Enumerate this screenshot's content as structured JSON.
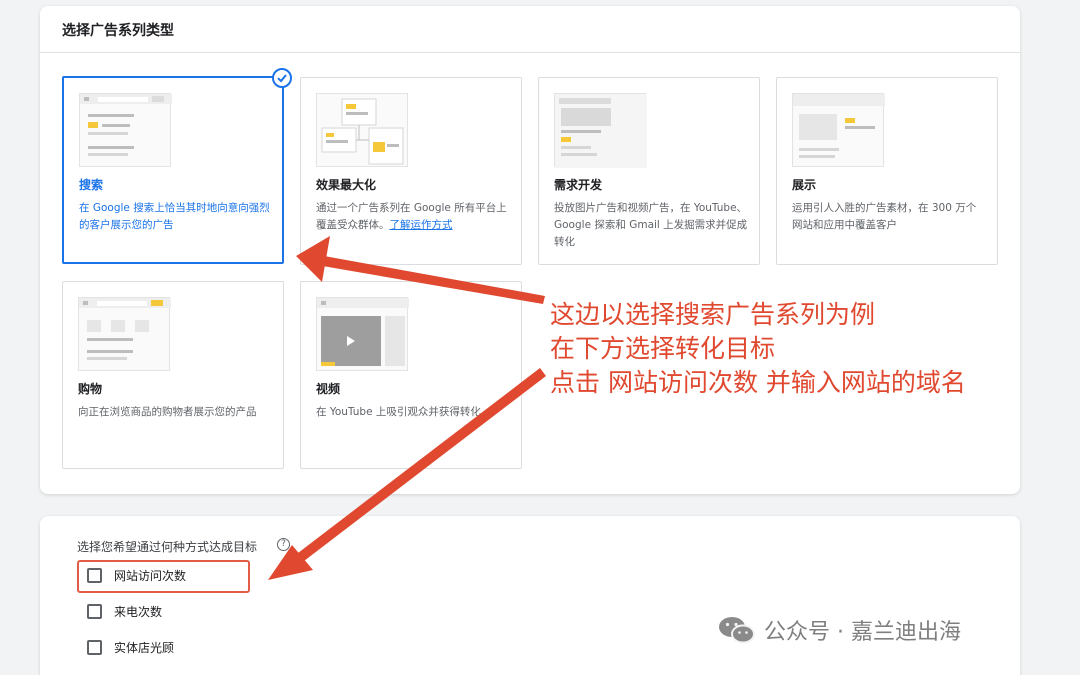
{
  "campaign_type": {
    "title": "选择广告系列类型",
    "cards": [
      {
        "title": "搜索",
        "desc": "在 Google 搜索上恰当其时地向意向强烈的客户展示您的广告",
        "selected": true
      },
      {
        "title": "效果最大化",
        "desc": "通过一个广告系列在 Google 所有平台上覆盖受众群体。",
        "link": "了解运作方式"
      },
      {
        "title": "需求开发",
        "desc": "投放图片广告和视频广告，在 YouTube、Google 探索和 Gmail 上发掘需求并促成转化"
      },
      {
        "title": "展示",
        "desc": "运用引人入胜的广告素材，在 300 万个网站和应用中覆盖客户"
      },
      {
        "title": "购物",
        "desc": "向正在浏览商品的购物者展示您的产品"
      },
      {
        "title": "视频",
        "desc": "在 YouTube 上吸引观众并获得转化"
      }
    ]
  },
  "goal": {
    "title": "选择您希望通过何种方式达成目标",
    "help_glyph": "?",
    "options": [
      {
        "label": "网站访问次数",
        "checked": false,
        "highlighted": true
      },
      {
        "label": "来电次数",
        "checked": false
      },
      {
        "label": "实体店光顾",
        "checked": false
      }
    ]
  },
  "annotation": {
    "lines": [
      "这边以选择搜索广告系列为例",
      "在下方选择转化目标",
      "点击 网站访问次数 并输入网站的域名"
    ],
    "color": "#e0492f"
  },
  "watermark": {
    "text": "公众号 · 嘉兰迪出海",
    "icon": "wechat-icon"
  },
  "colors": {
    "accent": "#1a73e8",
    "annotation": "#e0492f",
    "highlight_box": "#e25c46"
  }
}
